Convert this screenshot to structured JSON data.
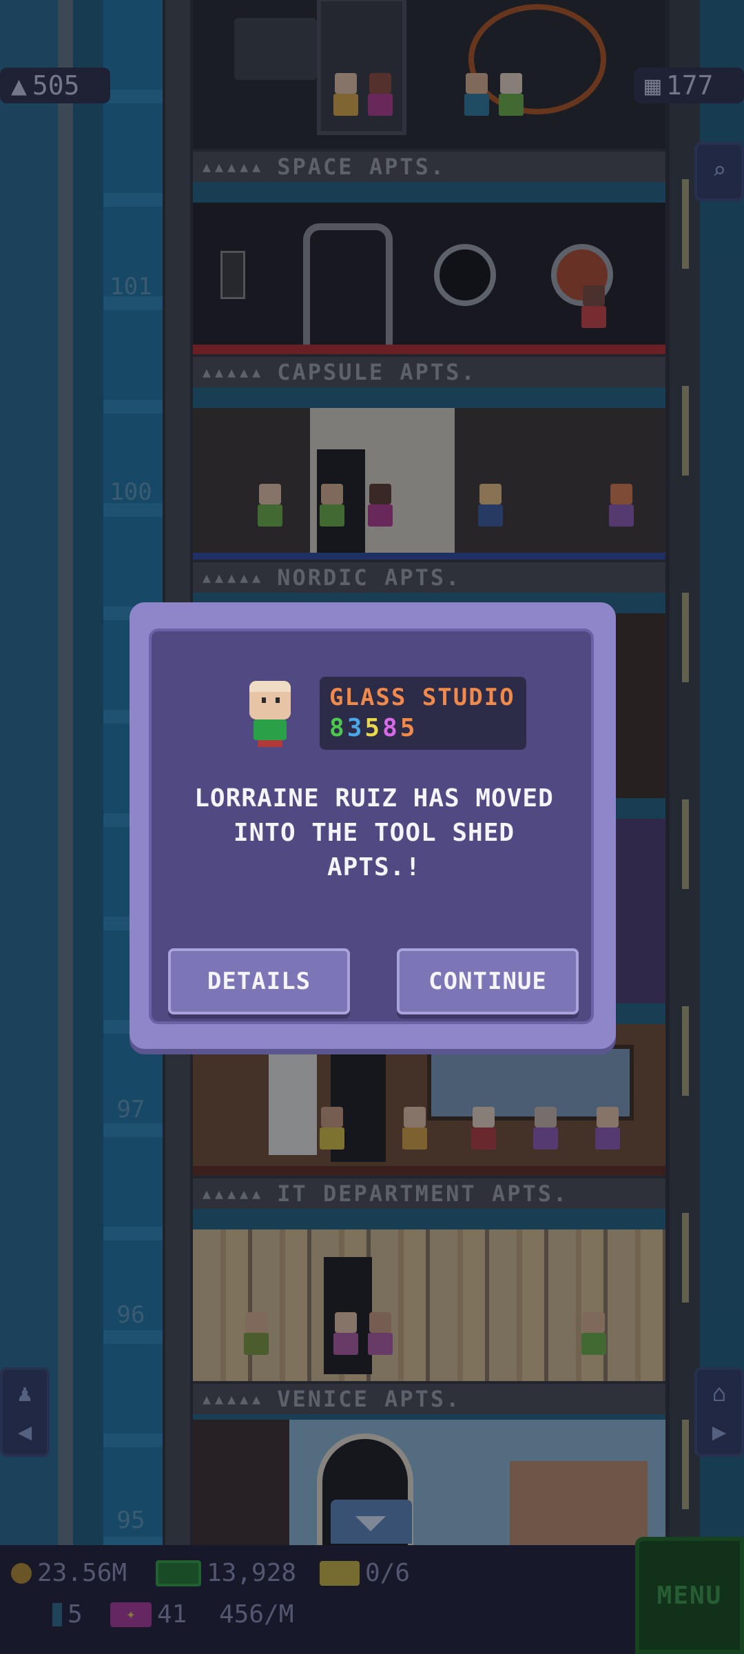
{
  "hud": {
    "population": "505",
    "floors": "177"
  },
  "floor_numbers": [
    "101",
    "100",
    "97",
    "96",
    "95"
  ],
  "floors": [
    {
      "name": "SPACE APTS.",
      "stars": "▲▲▲▲▲"
    },
    {
      "name": "CAPSULE APTS.",
      "stars": "▲▲▲▲▲"
    },
    {
      "name": "NORDIC APTS.",
      "stars": "▲▲▲▲▲"
    },
    {
      "name": "IT DEPARTMENT APTS.",
      "stars": "▲▲▲▲▲"
    },
    {
      "name": "VENICE APTS.",
      "stars": "▲▲▲▲▲"
    }
  ],
  "status_bar": {
    "coins": "23.56M",
    "bux": "13,928",
    "tickets": "0/6",
    "bitizens": "5",
    "vip": "41",
    "income": "456/M",
    "menu_label": "MENU"
  },
  "dialog": {
    "store_name": "GLASS STUDIO",
    "stock_digits": [
      "8",
      "3",
      "5",
      "8",
      "5"
    ],
    "message": "LORRAINE RUIZ HAS MOVED INTO THE TOOL SHED APTS.!",
    "details_label": "DETAILS",
    "continue_label": "CONTINUE"
  },
  "colors": {
    "dialog_outer": "#8e86c8",
    "dialog_inner": "#514a82",
    "store_name": "#f08a4a",
    "menu_green": "#124a18"
  },
  "icons": {
    "population": "person-icon",
    "floors": "building-icon",
    "search": "magnifier-icon",
    "elevator": "elevator-down-arrow-icon",
    "left_nav": "elevator-left-icon",
    "right_nav": "home-right-icon"
  }
}
